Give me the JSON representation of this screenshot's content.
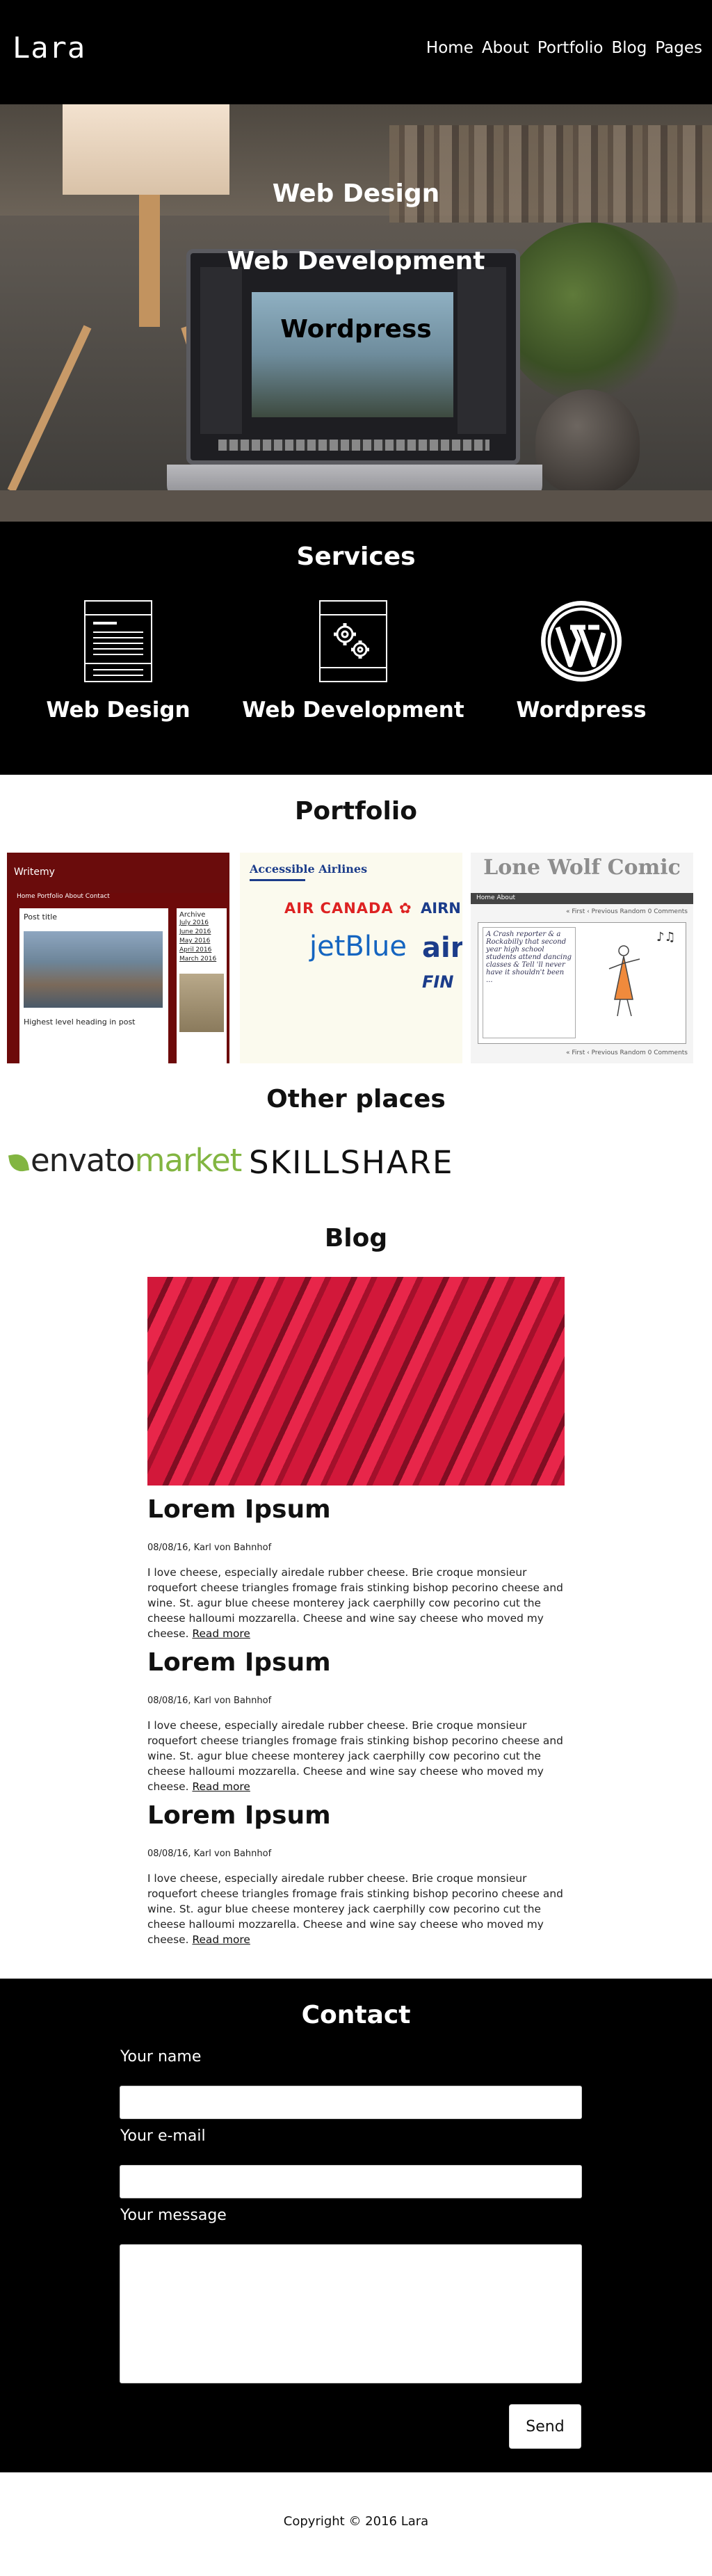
{
  "header": {
    "logo": "Lara",
    "nav": [
      "Home",
      "About",
      "Portfolio",
      "Blog",
      "Pages"
    ]
  },
  "hero": {
    "lines": [
      "Web Design",
      "Web Development",
      "Wordpress"
    ]
  },
  "services": {
    "title": "Services",
    "items": [
      {
        "label": "Web Design",
        "icon": "document-icon"
      },
      {
        "label": "Web Development",
        "icon": "gears-icon"
      },
      {
        "label": "Wordpress",
        "icon": "wordpress-icon"
      }
    ]
  },
  "portfolio": {
    "title": "Portfolio",
    "writemy": {
      "brand": "Writemy",
      "nav": "Home  Portfolio  About  Contact",
      "post_title": "Post title",
      "heading": "Highest level heading in post",
      "archive_title": "Archive",
      "archive": [
        "July 2016",
        "June 2016",
        "May 2016",
        "April 2016",
        "March 2016"
      ]
    },
    "airlines": {
      "title": "Accessible Airlines",
      "aircanada": "AIR CANADA",
      "airn": "AIRN",
      "jetblue": "jetBlue",
      "air": "air",
      "fin": "FIN"
    },
    "lonewolf": {
      "title": "Lone Wolf Comic",
      "bar": "Home  About",
      "nav": "« First   ‹ Previous   Random   0 Comments",
      "comic_text": "A Crash reporter & a Rockabilly that second year high school students attend dancing classes & Tell 'll never have it shouldn't been ..."
    }
  },
  "others": {
    "title": "Other places",
    "envato_main": "envato",
    "envato_market": "market",
    "skillshare": "SKILLSHARE"
  },
  "blog": {
    "title": "Blog",
    "read_more": "Read more",
    "posts": [
      {
        "title": "Lorem Ipsum",
        "meta": "08/08/16, Karl von Bahnhof",
        "body": "I love cheese, especially airedale rubber cheese. Brie croque monsieur roquefort cheese triangles fromage frais stinking bishop pecorino cheese and wine. St. agur blue cheese monterey jack caerphilly cow pecorino cut the cheese halloumi mozzarella. Cheese and wine say cheese who moved my cheese."
      },
      {
        "title": "Lorem Ipsum",
        "meta": "08/08/16, Karl von Bahnhof",
        "body": "I love cheese, especially airedale rubber cheese. Brie croque monsieur roquefort cheese triangles fromage frais stinking bishop pecorino cheese and wine. St. agur blue cheese monterey jack caerphilly cow pecorino cut the cheese halloumi mozzarella. Cheese and wine say cheese who moved my cheese."
      },
      {
        "title": "Lorem Ipsum",
        "meta": "08/08/16, Karl von Bahnhof",
        "body": "I love cheese, especially airedale rubber cheese. Brie croque monsieur roquefort cheese triangles fromage frais stinking bishop pecorino cheese and wine. St. agur blue cheese monterey jack caerphilly cow pecorino cut the cheese halloumi mozzarella. Cheese and wine say cheese who moved my cheese."
      }
    ]
  },
  "contact": {
    "title": "Contact",
    "name_label": "Your name",
    "email_label": "Your e-mail",
    "message_label": "Your message",
    "send": "Send"
  },
  "footer": {
    "text": "Copyright © 2016 Lara"
  }
}
